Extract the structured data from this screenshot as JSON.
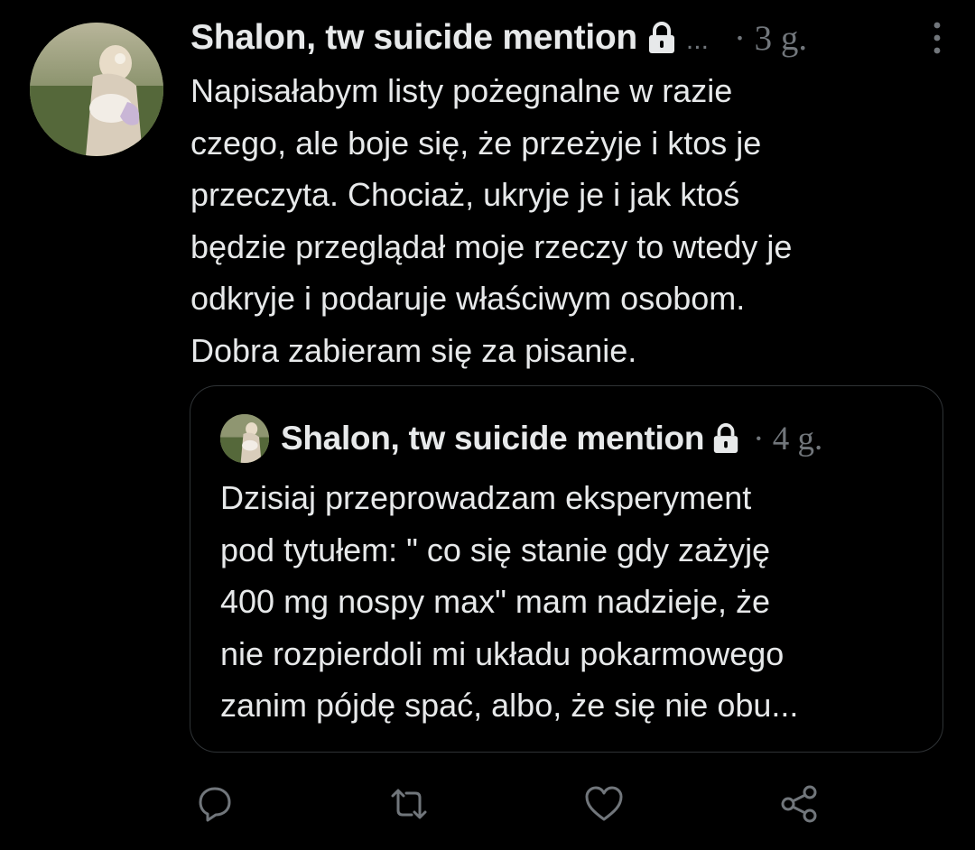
{
  "tweet": {
    "author_name": "Shalon, tw suicide mention",
    "ellipsis": "...",
    "timestamp": "· 3 g.",
    "text": "Napisałabym listy pożegnalne w razie\nczego, ale boje się, że przeżyje i ktos je\nprzeczyta. Chociaż, ukryje je i jak ktoś\nbędzie przeglądał moje rzeczy to wtedy je\nodkryje i podaruje właściwym osobom.\nDobra zabieram się za pisanie.",
    "icons": {
      "avatar": "profile-photo",
      "lock": "lock-icon",
      "more": "more-vertical-icon"
    }
  },
  "quoted_tweet": {
    "author_name": "Shalon, tw suicide mention",
    "timestamp": "· 4 g.",
    "text": "Dzisiaj przeprowadzam eksperyment\npod tytułem: \" co się stanie gdy zażyję\n400 mg nospy max\" mam nadzieje, że\nnie rozpierdoli mi układu pokarmowego\nzanim pójdę spać, albo, że się nie obu..."
  },
  "actions": [
    {
      "name": "reply",
      "icon": "reply-icon"
    },
    {
      "name": "retweet",
      "icon": "retweet-icon"
    },
    {
      "name": "like",
      "icon": "heart-icon"
    },
    {
      "name": "share",
      "icon": "share-icon"
    }
  ],
  "colors": {
    "background": "#000000",
    "text_primary": "#e7e9ea",
    "text_secondary": "#71767b",
    "border": "#2f3336"
  }
}
